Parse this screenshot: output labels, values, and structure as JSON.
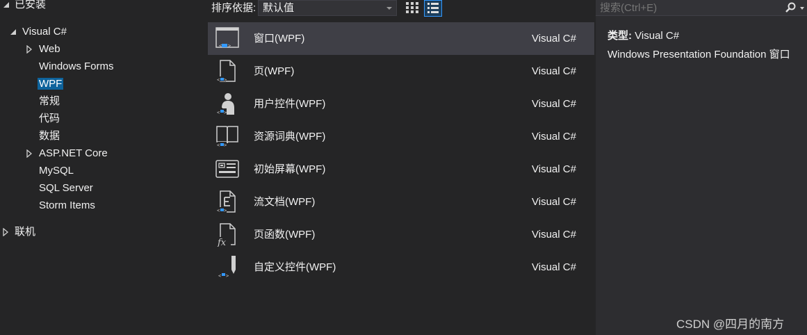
{
  "tree": {
    "installed_label": "已安装",
    "visual_csharp_label": "Visual C#",
    "children": [
      {
        "label": "Web",
        "expandable": true
      },
      {
        "label": "Windows Forms",
        "expandable": false
      },
      {
        "label": "WPF",
        "expandable": false,
        "selected": true
      },
      {
        "label": "常规",
        "expandable": false
      },
      {
        "label": "代码",
        "expandable": false
      },
      {
        "label": "数据",
        "expandable": false
      },
      {
        "label": "ASP.NET Core",
        "expandable": true
      },
      {
        "label": "MySQL",
        "expandable": false
      },
      {
        "label": "SQL Server",
        "expandable": false
      },
      {
        "label": "Storm Items",
        "expandable": false
      }
    ],
    "online_label": "联机"
  },
  "sortbar": {
    "label": "排序依据:",
    "selected": "默认值"
  },
  "templates": [
    {
      "name": "窗口(WPF)",
      "lang": "Visual C#",
      "icon": "window-icon",
      "active": true
    },
    {
      "name": "页(WPF)",
      "lang": "Visual C#",
      "icon": "page-icon"
    },
    {
      "name": "用户控件(WPF)",
      "lang": "Visual C#",
      "icon": "user-control-icon"
    },
    {
      "name": "资源词典(WPF)",
      "lang": "Visual C#",
      "icon": "resource-dictionary-icon"
    },
    {
      "name": "初始屏幕(WPF)",
      "lang": "Visual C#",
      "icon": "splash-screen-icon"
    },
    {
      "name": "流文档(WPF)",
      "lang": "Visual C#",
      "icon": "flow-document-icon"
    },
    {
      "name": "页函数(WPF)",
      "lang": "Visual C#",
      "icon": "page-function-icon"
    },
    {
      "name": "自定义控件(WPF)",
      "lang": "Visual C#",
      "icon": "custom-control-icon"
    }
  ],
  "search": {
    "placeholder": "搜索(Ctrl+E)"
  },
  "details": {
    "type_key": "类型:",
    "type_value": "Visual C#",
    "description": "Windows Presentation Foundation 窗口"
  },
  "watermark": "CSDN @四月的南方",
  "colors": {
    "background": "#252526",
    "panel": "#2d2d30",
    "selection": "#0e639c",
    "active_row": "#3f3f46",
    "accent": "#3399ff"
  }
}
